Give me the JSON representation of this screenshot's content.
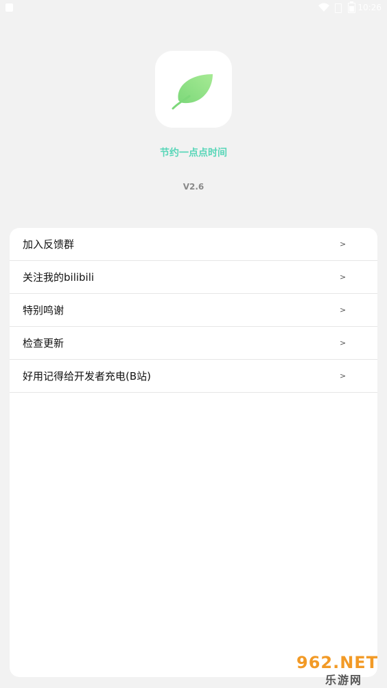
{
  "status_bar": {
    "time": "10:26",
    "icons": [
      "notification-icon",
      "wifi-icon",
      "sim-icon",
      "battery-icon"
    ]
  },
  "app": {
    "icon": "leaf-icon",
    "slogan": "节约一点点时间",
    "version": "V2.6",
    "accent_color": "#58d6b8"
  },
  "menu": {
    "items": [
      {
        "label": "加入反馈群",
        "arrow": ">"
      },
      {
        "label": "关注我的bilibili",
        "arrow": ">"
      },
      {
        "label": "特别鸣谢",
        "arrow": ">"
      },
      {
        "label": "检查更新",
        "arrow": ">"
      },
      {
        "label": "好用记得给开发者充电(B站)",
        "arrow": ">"
      }
    ]
  },
  "watermark": {
    "top": "962.NET",
    "bottom": "乐游网"
  }
}
